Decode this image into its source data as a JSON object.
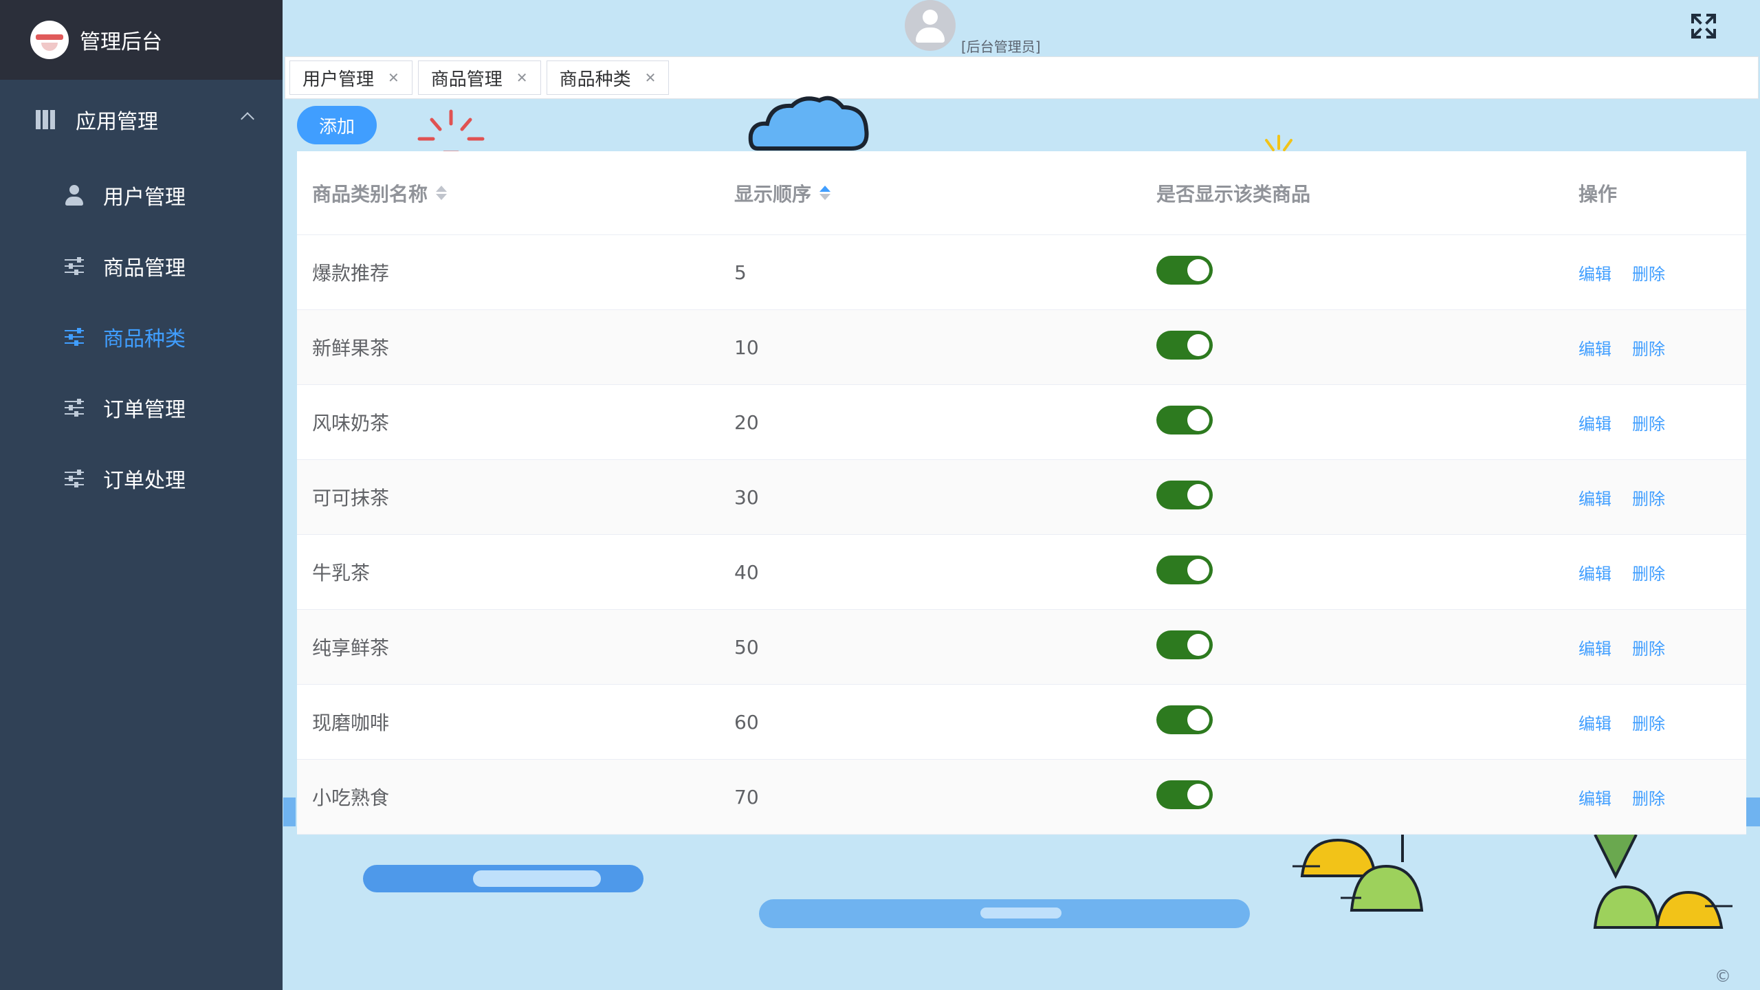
{
  "app": {
    "title": "管理后台",
    "role": "[后台管理员]"
  },
  "sidebar": {
    "group_label": "应用管理",
    "items": [
      {
        "label": "用户管理",
        "icon": "user-icon"
      },
      {
        "label": "商品管理",
        "icon": "sliders-icon"
      },
      {
        "label": "商品种类",
        "icon": "sliders-icon",
        "active": true
      },
      {
        "label": "订单管理",
        "icon": "sliders-icon"
      },
      {
        "label": "订单处理",
        "icon": "sliders-icon"
      }
    ]
  },
  "tabs": [
    {
      "label": "用户管理"
    },
    {
      "label": "商品管理"
    },
    {
      "label": "商品种类"
    }
  ],
  "toolbar": {
    "add_label": "添加"
  },
  "table": {
    "headers": [
      "商品类别名称",
      "显示顺序",
      "是否显示该类商品",
      "操作"
    ],
    "actions": {
      "edit": "编辑",
      "delete": "删除"
    },
    "rows": [
      {
        "name": "爆款推荐",
        "order": "5",
        "show": true
      },
      {
        "name": "新鲜果茶",
        "order": "10",
        "show": true
      },
      {
        "name": "风味奶茶",
        "order": "20",
        "show": true
      },
      {
        "name": "可可抹茶",
        "order": "30",
        "show": true
      },
      {
        "name": "牛乳茶",
        "order": "40",
        "show": true
      },
      {
        "name": "纯享鲜茶",
        "order": "50",
        "show": true
      },
      {
        "name": "现磨咖啡",
        "order": "60",
        "show": true
      },
      {
        "name": "小吃熟食",
        "order": "70",
        "show": true
      }
    ]
  },
  "footer": {
    "copyright": "©"
  },
  "colors": {
    "sidebar_bg": "#304156",
    "accent": "#409eff",
    "switch_on": "#2d7a1f",
    "page_bg": "#c5e5f6"
  }
}
